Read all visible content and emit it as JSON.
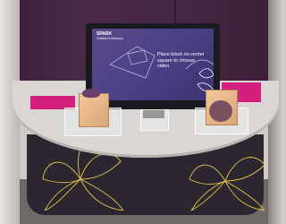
{
  "screen": {
    "brand": "SPARK",
    "brand_sub": "Children's Museum",
    "instruction": "Place block on center square to choose video"
  },
  "colors": {
    "wall": "#452643",
    "accent_pink": "#d4207d",
    "screen_purple": "#4a3f86",
    "counter": "#d9d6d3",
    "cabinet": "#2c2630",
    "flower_lines": "#e3c64a",
    "block_wood": "#e6b787"
  }
}
